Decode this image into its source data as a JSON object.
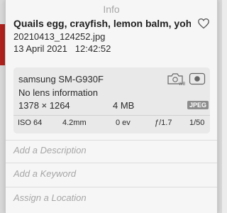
{
  "window": {
    "title": "Info"
  },
  "photo": {
    "title": "Quails egg, crayfish, lemon balm, yohur...",
    "filename": "20210413_124252.jpg",
    "date": "13 April 2021",
    "time": "12:42:52"
  },
  "camera": {
    "model": "samsung SM-G930F",
    "lens": "No lens information",
    "dimensions": "1378 × 1264",
    "file_size": "4 MB",
    "format_badge": "JPEG"
  },
  "exif": {
    "iso": "ISO 64",
    "focal_length": "4.2mm",
    "exposure_bias": "0 ev",
    "aperture": "ƒ/1.7",
    "shutter": "1/50"
  },
  "fields": {
    "description_placeholder": "Add a Description",
    "keyword_placeholder": "Add a Keyword",
    "location_placeholder": "Assign a Location"
  },
  "icons": {
    "favorite": "heart-icon",
    "white_balance": "white-balance-icon",
    "metering": "metering-icon"
  }
}
